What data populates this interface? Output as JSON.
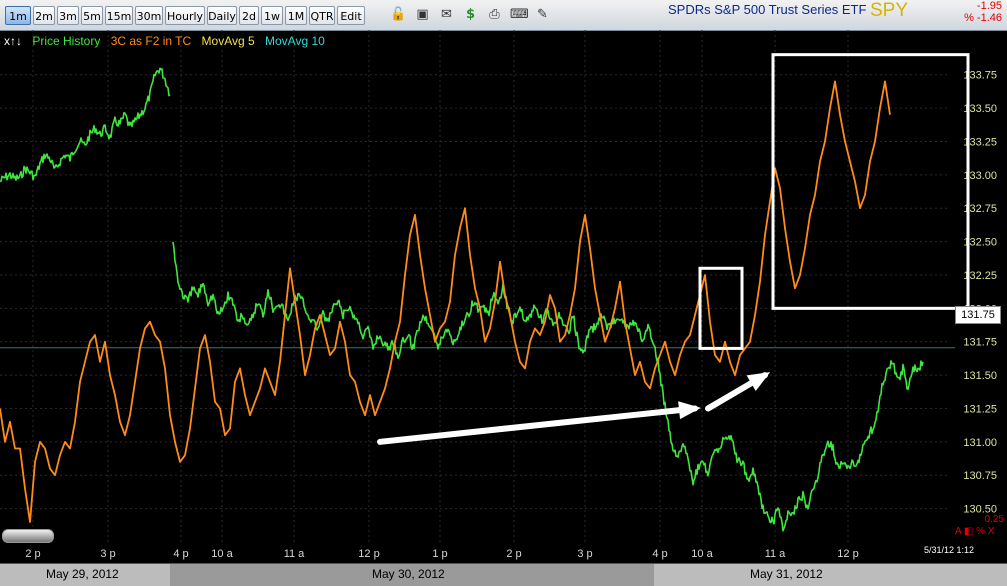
{
  "toolbar": {
    "intervals": [
      "1m",
      "2m",
      "3m",
      "5m",
      "15m",
      "30m",
      "Hourly",
      "Daily",
      "2d",
      "1w",
      "1M",
      "QTR",
      "Edit"
    ],
    "active_interval": "1m",
    "icons": [
      "unlock-icon",
      "save-icon",
      "mail-icon",
      "dollar-icon",
      "print-icon",
      "keyboard-icon",
      "pencil-icon"
    ]
  },
  "header": {
    "ticker_name": "SPDRs S&P 500 Trust Series ETF",
    "symbol": "SPY",
    "change": "-1.95",
    "change_pct": "% -1.46"
  },
  "legend": {
    "arrows": "x↑↓",
    "items": [
      {
        "label": "Price History",
        "color": "#3ee63e"
      },
      {
        "label": "3C as F2 in TC",
        "color": "#ff8c1a"
      },
      {
        "label": "MovAvg 5",
        "color": "#f2e14a"
      },
      {
        "label": "MovAvg 10",
        "color": "#38d6d6"
      }
    ]
  },
  "price_tag": "131.75",
  "zoom": {
    "value": "0.25",
    "controls": "A ◧ % X"
  },
  "timestamp": "5/31/12 1:12",
  "dates": [
    "May 29, 2012",
    "May 30, 2012",
    "May 31, 2012"
  ],
  "colors": {
    "price": "#3ee63e",
    "indicator": "#ff8c1a",
    "grid": "#2a2a2a",
    "axis_text": "#d6e6a0",
    "annotation": "#ffffff"
  },
  "chart_data": {
    "type": "line",
    "title": "SPDRs S&P 500 Trust Series ETF",
    "ylim": [
      130.25,
      133.875
    ],
    "y_ticks": [
      133.75,
      133.5,
      133.25,
      133.0,
      132.75,
      132.5,
      132.25,
      132.0,
      131.75,
      131.5,
      131.25,
      131.0,
      130.75,
      130.5
    ],
    "y_tick_labels": [
      "133.75",
      "133.50",
      "133.25",
      "133.00",
      "132.75",
      "132.50",
      "132.25",
      "132.00",
      "131.75",
      "131.50",
      "131.25",
      "131.00",
      "130.75",
      "130.50"
    ],
    "x_tick_labels": [
      "2 p",
      "3 p",
      "4 p",
      "10 a",
      "11 a",
      "12 p",
      "1 p",
      "2 p",
      "3 p",
      "4 p",
      "10 a",
      "11 a",
      "12 p"
    ],
    "series": [
      {
        "name": "Price History",
        "segments": [
          {
            "x": [
              0,
              5,
              10,
              15,
              20,
              25,
              30,
              35,
              40,
              45,
              50,
              55,
              60,
              65,
              70,
              75,
              80,
              85,
              90,
              95,
              100,
              105,
              110,
              115,
              120,
              125,
              130,
              135,
              140,
              145,
              150,
              155,
              160,
              165,
              170
            ],
            "y": [
              132.95,
              132.98,
              133.0,
              132.97,
              132.98,
              133.05,
              133.02,
              132.98,
              133.08,
              133.15,
              133.12,
              133.03,
              133.1,
              133.15,
              133.12,
              133.2,
              133.25,
              133.22,
              133.3,
              133.35,
              133.3,
              133.35,
              133.28,
              133.4,
              133.38,
              133.45,
              133.35,
              133.4,
              133.45,
              133.5,
              133.6,
              133.75,
              133.8,
              133.72,
              133.6
            ]
          },
          {
            "x": [
              173,
              178,
              183,
              188,
              193,
              198,
              203,
              208,
              213,
              218,
              223,
              228,
              233,
              238,
              243,
              248,
              253,
              258,
              263,
              268,
              273,
              278,
              283,
              288,
              293,
              298,
              303,
              308,
              313,
              318,
              323,
              328,
              333,
              338,
              343,
              348,
              353,
              358,
              363,
              368,
              373,
              378,
              383,
              388,
              393,
              398,
              403,
              408,
              413,
              418,
              423,
              428,
              433,
              438,
              443,
              448,
              453,
              458,
              463,
              468,
              473,
              478,
              483,
              488,
              493,
              498,
              503,
              508,
              513,
              518,
              523,
              528,
              533,
              538,
              543,
              548,
              553,
              558,
              563,
              568,
              573,
              578,
              583,
              588,
              593,
              598,
              603,
              608,
              613,
              618,
              623,
              628,
              633,
              638,
              643,
              648,
              653,
              658,
              663,
              668,
              673,
              678,
              683,
              688,
              693,
              698,
              703,
              708,
              713,
              718,
              723,
              728,
              733,
              738,
              743,
              748,
              753,
              758,
              763,
              768,
              773,
              778,
              783,
              788,
              793,
              798,
              803,
              808,
              813,
              818,
              823,
              828,
              833,
              838,
              843,
              848,
              853,
              858,
              863,
              868,
              873,
              878,
              883,
              888,
              893,
              898,
              903,
              908,
              913,
              918,
              923
            ],
            "y": [
              132.5,
              132.2,
              132.1,
              132.05,
              132.15,
              132.1,
              132.2,
              132.05,
              132.1,
              131.95,
              132.0,
              132.1,
              132.05,
              131.9,
              131.95,
              131.85,
              131.95,
              132.05,
              131.95,
              132.15,
              132.0,
              132.05,
              132.0,
              131.9,
              132.05,
              132.1,
              132.05,
              131.95,
              131.9,
              131.85,
              131.95,
              131.9,
              132.0,
              132.05,
              131.95,
              132.0,
              131.95,
              131.9,
              131.8,
              131.85,
              131.7,
              131.8,
              131.75,
              131.7,
              131.75,
              131.65,
              131.75,
              131.8,
              131.7,
              131.85,
              131.95,
              131.9,
              131.85,
              131.7,
              131.8,
              131.85,
              131.75,
              131.8,
              131.9,
              131.95,
              132.05,
              132.0,
              132.0,
              131.95,
              132.1,
              132.05,
              132.15,
              132.0,
              131.9,
              132.0,
              131.95,
              131.9,
              132.0,
              131.95,
              131.9,
              132.0,
              131.85,
              131.95,
              131.9,
              131.8,
              131.95,
              131.75,
              131.65,
              131.8,
              131.85,
              131.9,
              131.95,
              131.85,
              131.9,
              131.95,
              131.9,
              131.85,
              131.9,
              131.85,
              131.75,
              131.85,
              131.75,
              131.6,
              131.35,
              131.15,
              130.95,
              130.9,
              131.0,
              130.85,
              130.7,
              130.8,
              130.85,
              130.75,
              130.9,
              130.95,
              131.0,
              131.05,
              131.0,
              130.85,
              130.85,
              130.7,
              130.8,
              130.65,
              130.5,
              130.45,
              130.4,
              130.5,
              130.35,
              130.45,
              130.45,
              130.55,
              130.6,
              130.5,
              130.65,
              130.75,
              130.9,
              131.0,
              130.95,
              130.8,
              130.85,
              130.8,
              130.85,
              130.85,
              130.95,
              131.05,
              131.1,
              131.25,
              131.45,
              131.55,
              131.6,
              131.45,
              131.55,
              131.4,
              131.55,
              131.55,
              131.6,
              131.6,
              131.75,
              131.9,
              131.75
            ]
          }
        ]
      },
      {
        "name": "3C as F2 in TC",
        "segments": [
          {
            "x": [
              0,
              5,
              10,
              15,
              20,
              25,
              30,
              35,
              40,
              45,
              50,
              55,
              60,
              65,
              70,
              75,
              80,
              85,
              90,
              95,
              100,
              105,
              110,
              115,
              120,
              125,
              130,
              135,
              140,
              145,
              150,
              155,
              160,
              165,
              170,
              175,
              180,
              185,
              190,
              195,
              200,
              205,
              210,
              215,
              220,
              225,
              230,
              235,
              240,
              245,
              250,
              255,
              260,
              265,
              270,
              275,
              280,
              285,
              290,
              295,
              300,
              305,
              310,
              315,
              320,
              325,
              330,
              335,
              340,
              345,
              350,
              355,
              360,
              365,
              370,
              375,
              380,
              385,
              390,
              395,
              400,
              405,
              410,
              415,
              420,
              425,
              430,
              435,
              440,
              445,
              450,
              455,
              460,
              465,
              470,
              475,
              480,
              485,
              490,
              495,
              500,
              505,
              510,
              515,
              520,
              525,
              530,
              535,
              540,
              545,
              550,
              555,
              560,
              565,
              570,
              575,
              580,
              585,
              590,
              595,
              600,
              605,
              610,
              615,
              620,
              625,
              630,
              635,
              640,
              645,
              650,
              655,
              660,
              665,
              670,
              675,
              680,
              685,
              690,
              695,
              700,
              705,
              710,
              715,
              720,
              725,
              730,
              735,
              740,
              745,
              750,
              755,
              760,
              765,
              770,
              775,
              780,
              785,
              790,
              795,
              800,
              805,
              810,
              815,
              820,
              825,
              830,
              835,
              840,
              845,
              850,
              855,
              860,
              865,
              870,
              875,
              880,
              885,
              890,
              895,
              900,
              905,
              910,
              915,
              920
            ],
            "y": [
              131.25,
              131.0,
              131.15,
              130.95,
              130.95,
              130.65,
              130.4,
              130.85,
              131.0,
              130.95,
              130.8,
              130.75,
              130.9,
              131.0,
              130.95,
              131.15,
              131.45,
              131.6,
              131.75,
              131.8,
              131.6,
              131.75,
              131.5,
              131.35,
              131.15,
              131.05,
              131.2,
              131.45,
              131.7,
              131.85,
              131.9,
              131.8,
              131.75,
              131.55,
              131.2,
              131.0,
              130.85,
              130.9,
              131.1,
              131.4,
              131.7,
              131.8,
              131.6,
              131.3,
              131.25,
              131.05,
              131.1,
              131.45,
              131.55,
              131.35,
              131.2,
              131.3,
              131.4,
              131.55,
              131.45,
              131.35,
              131.6,
              131.95,
              132.3,
              132.05,
              131.8,
              131.5,
              131.65,
              131.85,
              131.95,
              131.8,
              131.65,
              131.7,
              131.9,
              131.75,
              131.5,
              131.45,
              131.3,
              131.2,
              131.35,
              131.2,
              131.3,
              131.4,
              131.55,
              131.75,
              131.9,
              132.25,
              132.55,
              132.7,
              132.4,
              132.15,
              131.95,
              131.75,
              131.85,
              131.9,
              132.05,
              132.4,
              132.6,
              132.75,
              132.4,
              132.15,
              132.0,
              131.75,
              131.85,
              132.05,
              132.35,
              132.1,
              131.95,
              131.75,
              131.6,
              131.55,
              131.75,
              131.85,
              131.8,
              131.9,
              132.1,
              132.0,
              131.75,
              131.8,
              131.95,
              132.15,
              132.5,
              132.7,
              132.45,
              132.15,
              131.95,
              131.75,
              131.85,
              132.0,
              132.2,
              131.9,
              131.7,
              131.5,
              131.6,
              131.45,
              131.4,
              131.55,
              131.65,
              131.75,
              131.6,
              131.5,
              131.65,
              131.75,
              131.8,
              131.95,
              132.1,
              132.25,
              131.9,
              131.65,
              131.6,
              131.75,
              131.6,
              131.5,
              131.65,
              131.7,
              131.75,
              131.95,
              132.2,
              132.55,
              132.8,
              133.05,
              132.9,
              132.6,
              132.35,
              132.15,
              132.25,
              132.45,
              132.7,
              132.85,
              133.1,
              133.25,
              133.5,
              133.7,
              133.45,
              133.25,
              133.1,
              132.95,
              132.75,
              132.85,
              133.1,
              133.25,
              133.5,
              133.7,
              133.45
            ]
          }
        ]
      }
    ],
    "annotations": [
      {
        "type": "arrow",
        "from": [
          380,
          131.0
        ],
        "to": [
          695,
          131.25
        ]
      },
      {
        "type": "arrow",
        "from": [
          708,
          131.25
        ],
        "to": [
          765,
          131.5
        ]
      },
      {
        "type": "box",
        "x": [
          700,
          742
        ],
        "y": [
          131.7,
          132.3
        ]
      },
      {
        "type": "box",
        "x": [
          773,
          968
        ],
        "y": [
          132.0,
          133.9
        ]
      }
    ]
  }
}
